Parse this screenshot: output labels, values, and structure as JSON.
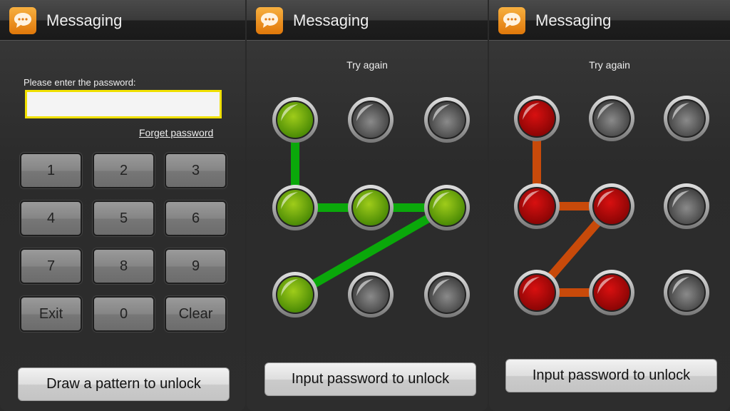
{
  "app_title": "Messaging",
  "icon": "chat-bubble-icon",
  "password_panel": {
    "prompt": "Please enter the password:",
    "password_value": "",
    "forgot_link": "Forget password",
    "keys": [
      "1",
      "2",
      "3",
      "4",
      "5",
      "6",
      "7",
      "8",
      "9",
      "Exit",
      "0",
      "Clear"
    ],
    "switch_button": "Draw a pattern to unlock"
  },
  "pattern_panels": [
    {
      "status": "Try again",
      "selected": [
        0,
        3,
        4,
        5,
        6
      ],
      "state": "success",
      "dot_color": "#9fcc1a",
      "line_color": "#0aa80a",
      "switch_button": "Input password to unlock"
    },
    {
      "status": "Try again",
      "selected": [
        0,
        3,
        4,
        6,
        7
      ],
      "state": "error",
      "dot_color": "#d81010",
      "line_color": "#c84a0a",
      "switch_button": "Input password to unlock"
    }
  ],
  "colors": {
    "input_border": "#f0e000",
    "icon": "#e88a1a"
  }
}
